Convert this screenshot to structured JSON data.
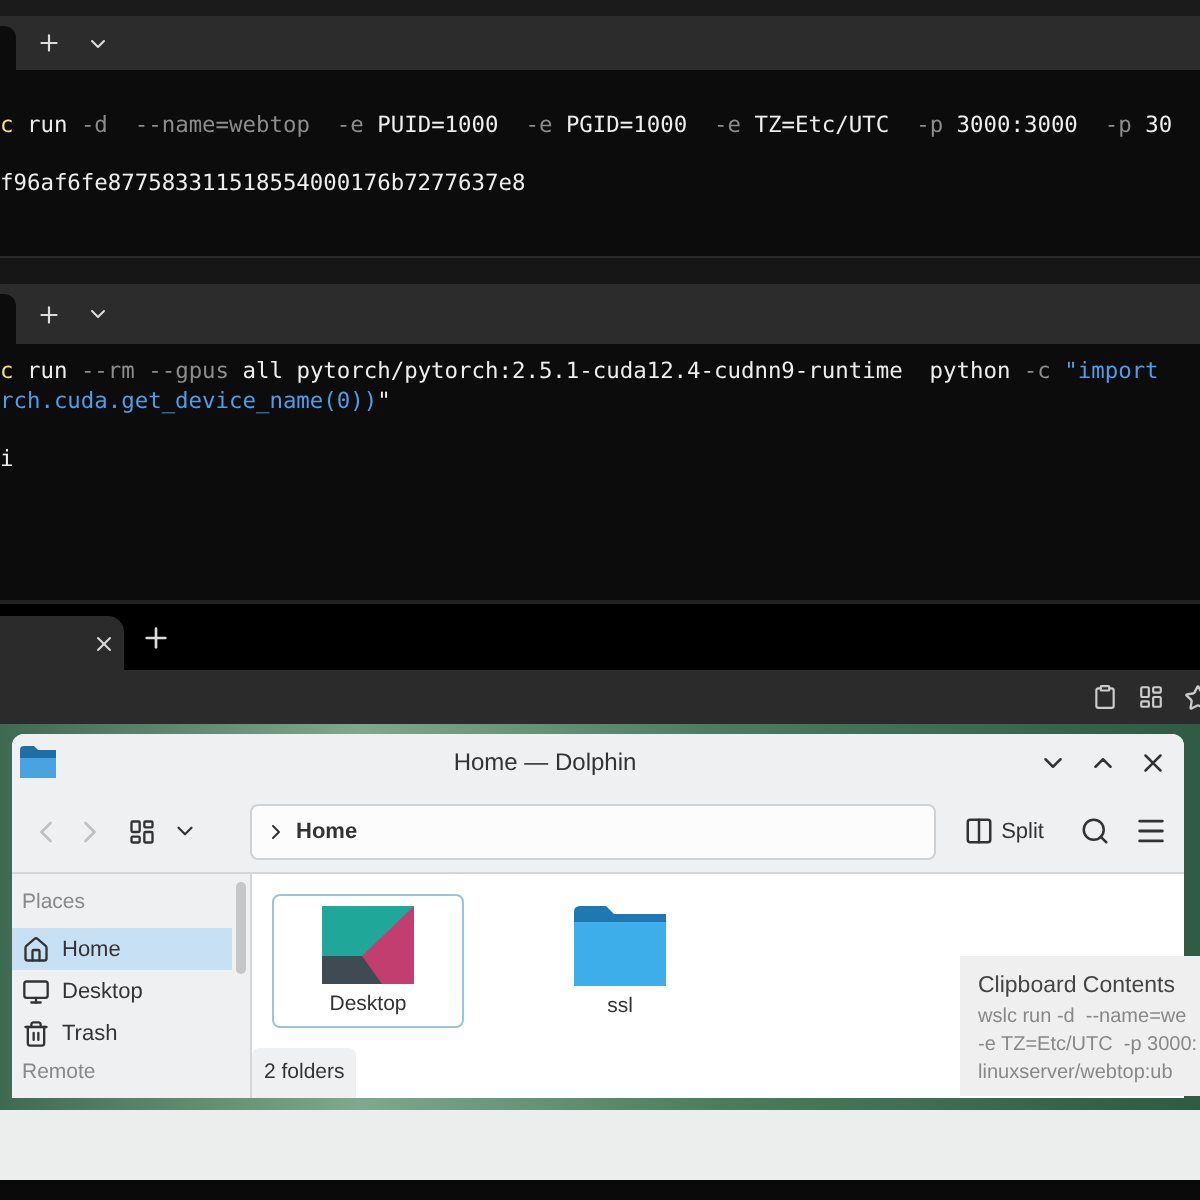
{
  "terminals": [
    {
      "lines": [
        {
          "kind": "command",
          "segments": [
            {
              "kind": "cmd",
              "text": "c"
            },
            {
              "kind": "plain",
              "text": " run "
            },
            {
              "kind": "flag",
              "text": "-d  --name=webtop  -e "
            },
            {
              "kind": "plain",
              "text": "PUID=1000  "
            },
            {
              "kind": "flag",
              "text": "-e "
            },
            {
              "kind": "plain",
              "text": "PGID=1000  "
            },
            {
              "kind": "flag",
              "text": "-e "
            },
            {
              "kind": "plain",
              "text": "TZ=Etc/UTC  "
            },
            {
              "kind": "flag",
              "text": "-p "
            },
            {
              "kind": "plain",
              "text": "3000:3000  "
            },
            {
              "kind": "flag",
              "text": "-p "
            },
            {
              "kind": "plain",
              "text": "30"
            }
          ]
        },
        {
          "kind": "output",
          "segments": [
            {
              "kind": "plain",
              "text": "f96af6fe877583311518554000176b7277637e8"
            }
          ]
        }
      ]
    },
    {
      "lines": [
        {
          "kind": "command",
          "segments": [
            {
              "kind": "cmd",
              "text": "c"
            },
            {
              "kind": "plain",
              "text": " run "
            },
            {
              "kind": "flag",
              "text": "--rm --gpus "
            },
            {
              "kind": "plain",
              "text": "all pytorch/pytorch:2.5.1-cuda12.4-cudnn9-runtime  python "
            },
            {
              "kind": "flag",
              "text": "-c "
            },
            {
              "kind": "string",
              "text": "\"import"
            }
          ]
        },
        {
          "kind": "command",
          "segments": [
            {
              "kind": "string",
              "text": "rch.cuda.get_device_name(0))"
            },
            {
              "kind": "plain",
              "text": "\""
            }
          ]
        },
        {
          "kind": "output",
          "segments": [
            {
              "kind": "plain",
              "text": "i"
            }
          ]
        }
      ]
    }
  ],
  "file_manager": {
    "title": "Home — Dolphin",
    "back_enabled": false,
    "forward_enabled": false,
    "breadcrumb": "Home",
    "split_label": "Split",
    "sidebar": [
      {
        "heading": "Places",
        "items": [
          {
            "label": "Home",
            "kind": "home",
            "selected": true
          },
          {
            "label": "Desktop",
            "kind": "desktop",
            "selected": false
          },
          {
            "label": "Trash",
            "kind": "trash",
            "selected": false
          }
        ]
      },
      {
        "heading": "Remote"
      }
    ],
    "files": [
      {
        "name": "Desktop",
        "kind": "wallpaper-folder",
        "selected": true
      },
      {
        "name": "ssl",
        "kind": "folder",
        "selected": false
      }
    ],
    "status": "2 folders"
  },
  "clipboard_popup": {
    "title": "Clipboard Contents",
    "lines": [
      "wslc run -d  --name=we",
      "-e TZ=Etc/UTC  -p 3000:",
      "linuxserver/webtop:ub"
    ]
  }
}
